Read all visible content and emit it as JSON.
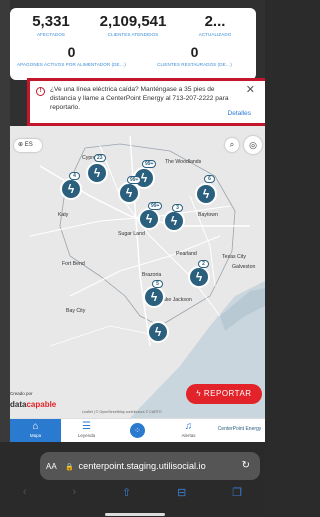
{
  "stats": {
    "affected": {
      "value": "5,331",
      "label": "AFECTADOS"
    },
    "served": {
      "value": "2,109,541",
      "label": "CLIENTES ATENDIDOS"
    },
    "updated": {
      "value": "2...",
      "label": "ACTUALIZADO"
    },
    "active_outages": {
      "value": "0",
      "label": "APAGONES ACTIVOS POR ALIMENTADOR (DE…)"
    },
    "restored": {
      "value": "0",
      "label": "CLIENTES RESTAURADOS (DE…)"
    }
  },
  "alert": {
    "message": "¿Ve una línea eléctrica caída? Manténgase a 35 pies de distancia y llame a CenterPoint Energy al 713-207-2222 para reportarlo.",
    "details_label": "Detalles",
    "close_symbol": "✕",
    "info_symbol": "!"
  },
  "map": {
    "language_button": "ES",
    "labels": {
      "the_woodlands": "The Woodlands",
      "cypress": "Cypress",
      "katy": "Katy",
      "sugar_land": "Sugar Land",
      "fort_bend": "Fort Bend",
      "brazoria": "Brazoria",
      "bay_city": "Bay City",
      "texas_city": "Texas City",
      "galveston": "Galveston",
      "baytown": "Baytown",
      "pearland": "Pearland",
      "lake_jackson": "Lake Jackson"
    },
    "pins": [
      {
        "badge": "23"
      },
      {
        "badge": "99+"
      },
      {
        "badge": "6"
      },
      {
        "badge": "4"
      },
      {
        "badge": "99+"
      },
      {
        "badge": "99+"
      },
      {
        "badge": "3"
      },
      {
        "badge": "2"
      },
      {
        "badge": "5"
      }
    ],
    "credit": "Creado por",
    "logo_prefix": "data",
    "logo_suffix": "capable",
    "report_button": "REPORTAR",
    "attribution": "Leaflet | © OpenStreetMap contributors © CARTO"
  },
  "tabs": [
    {
      "label": "Mapa",
      "icon": "map-icon",
      "active": true
    },
    {
      "label": "Leyenda",
      "icon": "legend-icon",
      "active": false
    },
    {
      "label": "",
      "icon": "grid-icon",
      "active": false
    },
    {
      "label": "Alertas",
      "icon": "bell-icon",
      "active": false
    },
    {
      "label": "CenterPoint Energy",
      "icon": "logo",
      "active": false
    }
  ],
  "browser": {
    "aa": "AA",
    "url": "centerpoint.staging.utilisocial.io"
  },
  "colors": {
    "accent": "#2a7ad0",
    "alert_border": "#c4172c",
    "pin": "#2a5f7e",
    "report": "#e2232a"
  }
}
